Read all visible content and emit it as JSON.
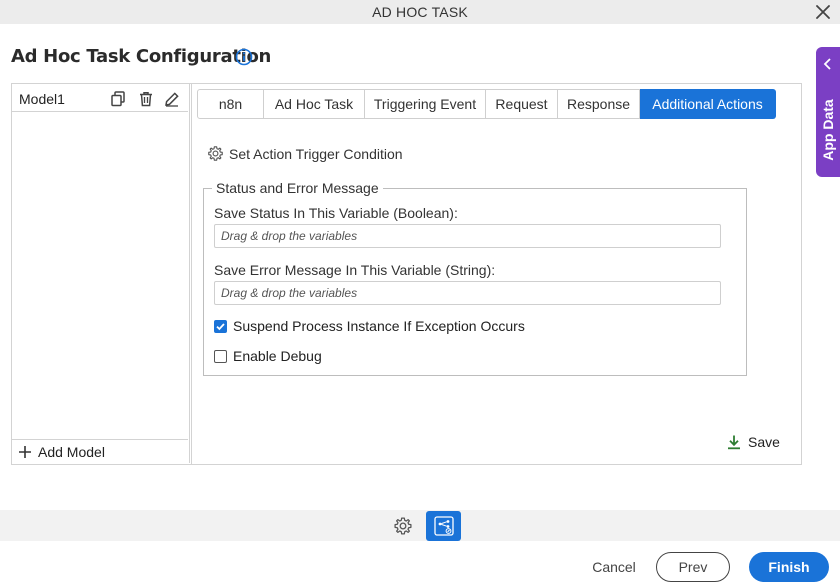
{
  "window": {
    "title": "AD HOC TASK"
  },
  "page": {
    "title": "Ad Hoc Task Configuration"
  },
  "side_tab": {
    "label": "App Data"
  },
  "models": {
    "items": [
      {
        "name": "Model1"
      }
    ],
    "add_label": "Add Model"
  },
  "tabs": [
    {
      "label": "n8n"
    },
    {
      "label": "Ad Hoc Task"
    },
    {
      "label": "Triggering Event"
    },
    {
      "label": "Request"
    },
    {
      "label": "Response"
    },
    {
      "label": "Additional Actions",
      "active": true
    }
  ],
  "actions": {
    "trigger_label": "Set Action Trigger Condition",
    "group_title": "Status and Error Message",
    "status_label": "Save Status In This Variable (Boolean):",
    "status_placeholder": "Drag & drop the variables",
    "error_label": "Save Error Message In This Variable (String):",
    "error_placeholder": "Drag & drop the variables",
    "suspend_label": "Suspend Process Instance If Exception Occurs",
    "suspend_checked": true,
    "debug_label": "Enable Debug",
    "debug_checked": false,
    "save_label": "Save"
  },
  "footer": {
    "cancel": "Cancel",
    "prev": "Prev",
    "finish": "Finish"
  },
  "colors": {
    "accent": "#1a73d8",
    "side_tab": "#7b3fc4",
    "save_icon": "#2e7d32"
  },
  "icons": {
    "close": "close-icon",
    "info": "info-icon",
    "chevron": "chevron-left-icon",
    "copy": "copy-icon",
    "delete": "trash-icon",
    "edit": "pencil-icon",
    "add": "plus-icon",
    "gear": "gear-icon",
    "save": "download-icon",
    "flow": "workflow-icon"
  }
}
